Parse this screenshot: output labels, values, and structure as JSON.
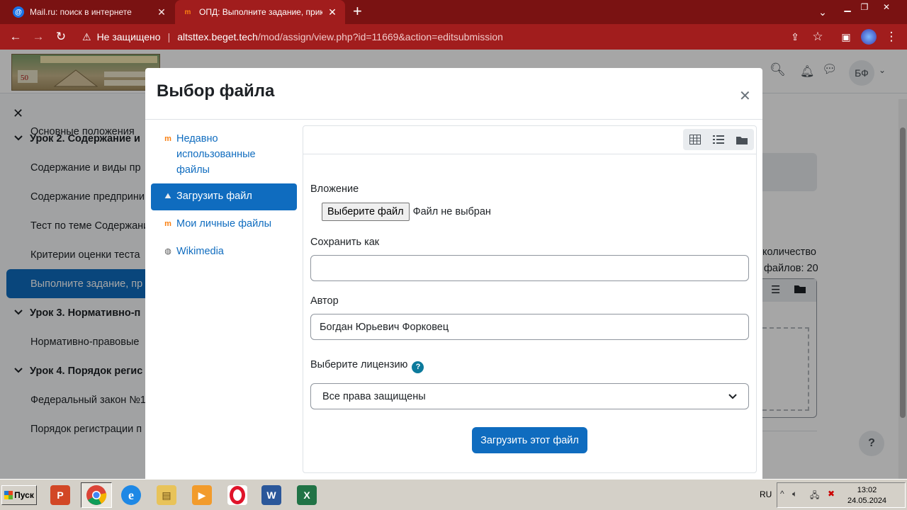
{
  "browser": {
    "tabs": [
      {
        "title": "Mail.ru: поиск в интернете",
        "icon": "mailru-icon",
        "active": false
      },
      {
        "title": "ОПД: Выполните задание, прикреп",
        "icon": "moodle-icon",
        "active": true
      }
    ],
    "insecure_label": "Не защищено",
    "url_host": "altsttex.beget.tech",
    "url_path": "/mod/assign/view.php?id=11669&action=editsubmission",
    "accent": "#a11d1d"
  },
  "navbar": {
    "user_initials": "БФ"
  },
  "drawer": {
    "clipped_top": "Основные положения",
    "items": [
      {
        "kind": "section",
        "label": "Урок 2. Содержание и"
      },
      {
        "kind": "activity",
        "label": "Содержание и виды пр"
      },
      {
        "kind": "activity",
        "label": "Содержание предприни"
      },
      {
        "kind": "activity",
        "label": "Тест по теме Содержани"
      },
      {
        "kind": "activity",
        "label": "Критерии оценки теста"
      },
      {
        "kind": "current",
        "label": "Выполните задание, пр"
      },
      {
        "kind": "section",
        "label": "Урок 3. Нормативно-п"
      },
      {
        "kind": "activity",
        "label": "Нормативно-правовые"
      },
      {
        "kind": "section",
        "label": "Урок 4. Порядок регис"
      },
      {
        "kind": "activity",
        "label": "Федеральный закон №1"
      },
      {
        "kind": "activity",
        "label": "Порядок регистрации п"
      }
    ]
  },
  "background": {
    "max_files_line1": "количество",
    "max_files_line2": "файлов: 20",
    "help_fab": "?"
  },
  "modal": {
    "title": "Выбор файла",
    "repositories": [
      {
        "label": "Недавно использованные файлы",
        "icon": "moodle-icon",
        "active": false
      },
      {
        "label": "Загрузить файл",
        "icon": "upload-icon",
        "active": true
      },
      {
        "label": "Мои личные файлы",
        "icon": "moodle-icon",
        "active": false
      },
      {
        "label": "Wikimedia",
        "icon": "wikimedia-icon",
        "active": false
      }
    ],
    "form": {
      "attachment_label": "Вложение",
      "choose_file_button": "Выберите файл",
      "no_file_text": "Файл не выбран",
      "save_as_label": "Сохранить как",
      "save_as_value": "",
      "author_label": "Автор",
      "author_value": "Богдан Юрьевич Форковец",
      "license_label": "Выберите лицензию",
      "license_value": "Все права защищены",
      "upload_button": "Загрузить этот файл"
    }
  },
  "taskbar": {
    "start_label": "Пуск",
    "language": "RU",
    "time": "13:02",
    "date": "24.05.2024"
  }
}
